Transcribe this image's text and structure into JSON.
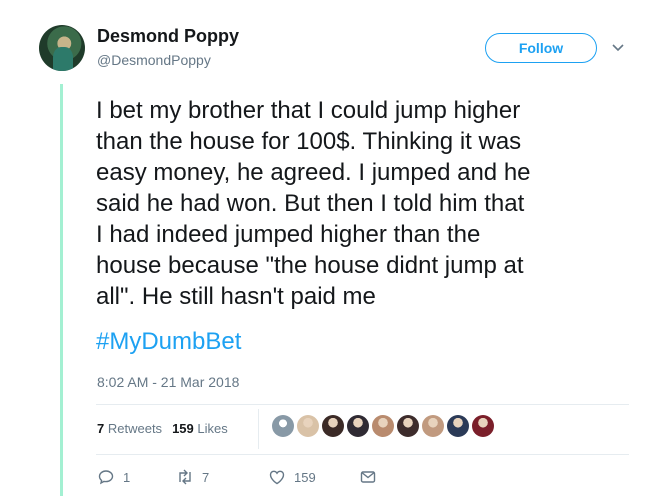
{
  "author": {
    "name": "Desmond Poppy",
    "handle": "@DesmondPoppy"
  },
  "follow_label": "Follow",
  "tweet": {
    "text": "I bet my brother that I could jump higher\nthan the house for 100$. Thinking it was\neasy money, he agreed. I jumped and he\nsaid he had won. But then I told him that\nI had indeed jumped higher than the\nhouse because \"the house didnt jump at\nall\". He still hasn't paid me",
    "hashtag": "#MyDumbBet",
    "timestamp": "8:02 AM - 21 Mar 2018"
  },
  "stats": {
    "retweets_count": "7",
    "retweets_label": "Retweets",
    "likes_count": "159",
    "likes_label": "Likes"
  },
  "likers": [
    {
      "icon": "default-avatar",
      "color": "#8899a6"
    },
    {
      "icon": "user-avatar",
      "color": "#d9c2a7"
    },
    {
      "icon": "user-avatar",
      "color": "#3b2a26"
    },
    {
      "icon": "user-avatar",
      "color": "#2f2a33"
    },
    {
      "icon": "user-avatar",
      "color": "#b98b6e"
    },
    {
      "icon": "user-avatar",
      "color": "#3d2c2c"
    },
    {
      "icon": "user-avatar",
      "color": "#c19a7f"
    },
    {
      "icon": "user-avatar",
      "color": "#2b3a57"
    },
    {
      "icon": "user-avatar",
      "color": "#7b1f2a"
    }
  ],
  "actions": {
    "reply_count": "1",
    "retweet_count": "7",
    "like_count": "159"
  },
  "colors": {
    "accent": "#1da1f2",
    "thread_line": "#a3f0d2",
    "muted": "#657786"
  }
}
